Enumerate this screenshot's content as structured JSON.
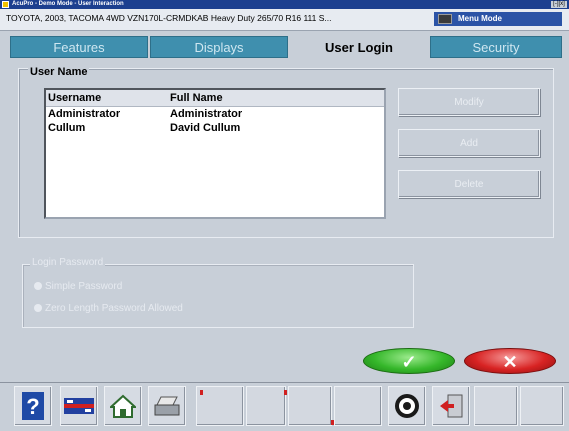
{
  "window": {
    "title": "AcuPro - Demo Mode - User Interaction",
    "controls": "[-][x]"
  },
  "vehicle": {
    "description": "TOYOTA, 2003, TACOMA 4WD VZN170L-CRMDKAB Heavy Duty 265/70 R16 111 S..."
  },
  "mode": {
    "label": "Menu Mode"
  },
  "tabs": [
    {
      "label": "Features",
      "active": false
    },
    {
      "label": "Displays",
      "active": false
    },
    {
      "label": "User Login",
      "active": true
    },
    {
      "label": "Security",
      "active": false
    }
  ],
  "user_group": {
    "title": "User Name",
    "columns": [
      "Username",
      "Full Name"
    ],
    "rows": [
      {
        "username": "Administrator",
        "full_name": "Administrator"
      },
      {
        "username": "Cullum",
        "full_name": "David Cullum"
      }
    ]
  },
  "actions": {
    "modify": "Modify",
    "add": "Add",
    "delete": "Delete"
  },
  "password_group": {
    "title": "Login Password",
    "options": [
      {
        "label": "Simple Password",
        "selected": false
      },
      {
        "label": "Zero Length Password Allowed",
        "selected": true
      }
    ]
  },
  "dialog": {
    "ok_glyph": "✓",
    "cancel_glyph": "✕"
  },
  "toolbar": {
    "icons": [
      "help-icon",
      "vehicle-specs-icon",
      "home-icon",
      "print-icon",
      "blank",
      "blank",
      "blank",
      "blank",
      "compass-icon",
      "exit-icon",
      "blank",
      "blank"
    ]
  },
  "colors": {
    "tab_inactive": "#3f8fae",
    "title_bar": "#1c3f8f",
    "ok": "#35b72a",
    "cancel": "#d82323"
  }
}
